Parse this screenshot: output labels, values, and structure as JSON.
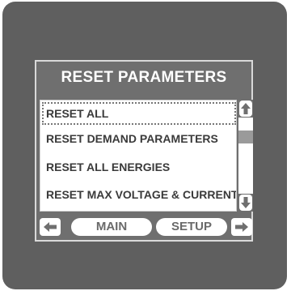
{
  "screen": {
    "title": "RESET PARAMETERS",
    "menu_items": [
      {
        "label": "RESET ALL",
        "selected": true
      },
      {
        "label": "RESET DEMAND PARAMETERS",
        "selected": false
      },
      {
        "label": "RESET ALL ENERGIES",
        "selected": false
      },
      {
        "label": "RESET MAX VOLTAGE & CURRENT",
        "selected": false
      }
    ]
  },
  "navigation": {
    "main_label": "MAIN",
    "setup_label": "SETUP",
    "back_icon": "arrow-left-icon",
    "forward_icon": "arrow-right-icon"
  },
  "scrollbar": {
    "up_icon": "arrow-up-icon",
    "down_icon": "arrow-down-icon"
  },
  "colors": {
    "bezel": "#5f5f5f",
    "screen": "#6f6f6f",
    "list_background": "#ffffff",
    "text": "#3a3a3a"
  }
}
